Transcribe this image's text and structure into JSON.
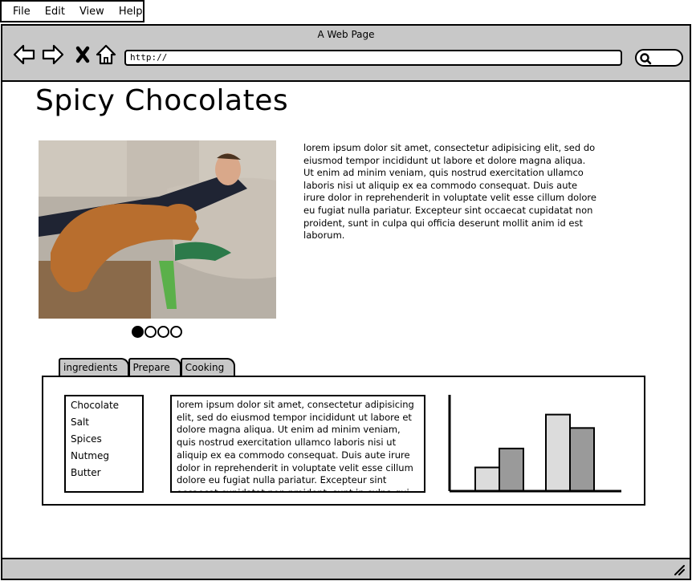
{
  "menu": {
    "items": [
      "File",
      "Edit",
      "View",
      "Help"
    ]
  },
  "browser": {
    "title": "A Web Page",
    "url": "http://",
    "icons": [
      "back-arrow-icon",
      "forward-arrow-icon",
      "stop-x-icon",
      "home-icon",
      "search-icon",
      "resize-grip-icon"
    ]
  },
  "page": {
    "title": "Spicy Chocolates",
    "body_text": "lorem ipsum dolor sit amet, consectetur adipisicing elit, sed do eiusmod tempor incididunt ut labore et dolore magna aliqua. Ut enim ad minim veniam, quis nostrud exercitation ullamco laboris nisi ut aliquip ex ea commodo consequat. Duis aute irure dolor in reprehenderit in voluptate velit esse cillum dolore eu fugiat nulla pariatur. Excepteur sint occaecat cupidatat non proident, sunt in culpa qui officia deserunt mollit anim id est laborum.",
    "carousel": {
      "count": 4,
      "active": 0
    }
  },
  "tabs": {
    "labels": [
      "ingredients",
      "Prepare",
      "Cooking"
    ],
    "active": 0
  },
  "ingredients": [
    "Chocolate",
    "Salt",
    "Spices",
    "Nutmeg",
    "Butter"
  ],
  "panel_text": "lorem ipsum dolor sit amet, consectetur adipisicing elit, sed do eiusmod tempor incididunt ut labore et dolore magna aliqua. Ut enim ad minim veniam, quis nostrud exercitation ullamco laboris nisi ut aliquip ex ea commodo consequat. Duis aute irure dolor in reprehenderit in voluptate velit esse cillum dolore eu fugiat nulla pariatur. Excepteur sint occaecat cupidatat non proident, sunt in culpa qui officia deserunt mollit anim id est laborum.",
  "colors": {
    "chrome": "#c8c8c8",
    "bar_light": "#dcdcdc",
    "bar_dark": "#9a9a9a"
  },
  "chart_data": {
    "type": "bar",
    "categories": [
      "",
      ""
    ],
    "series": [
      {
        "values": [
          30,
          97
        ]
      },
      {
        "values": [
          54,
          80
        ]
      }
    ],
    "ylim": [
      0,
      120
    ]
  }
}
